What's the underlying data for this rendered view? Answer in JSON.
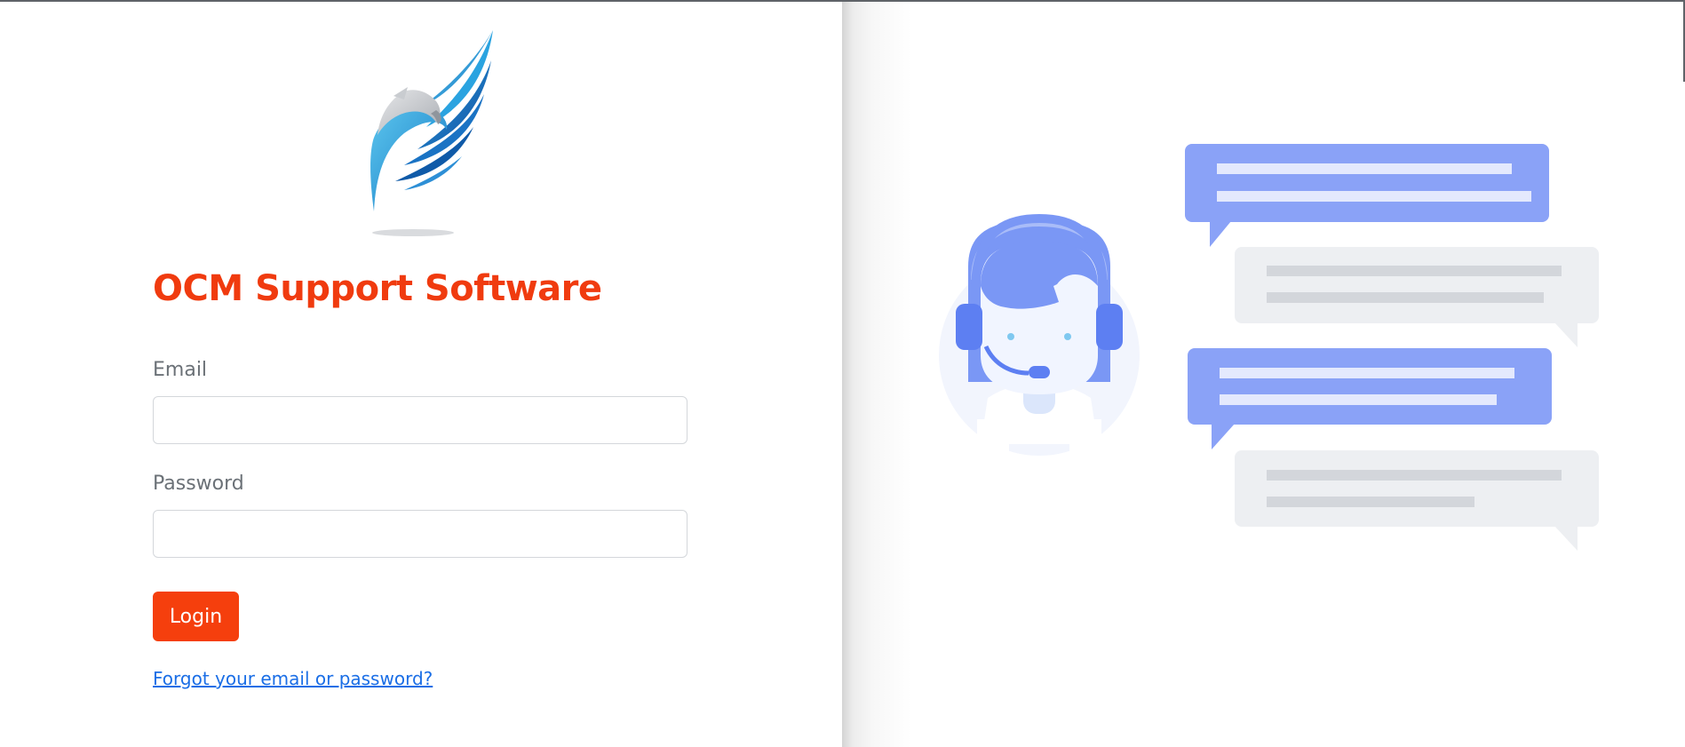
{
  "app": {
    "title": "OCM Support Software",
    "accent_color": "#f53f0d",
    "logo": "eagle-logo-icon"
  },
  "login_form": {
    "email_label": "Email",
    "email_value": "",
    "password_label": "Password",
    "password_value": "",
    "login_button": "Login",
    "forgot_link": "Forgot your email or password?"
  },
  "illustration": {
    "agent": "support-agent-headset-icon",
    "bubbles": [
      "chat-bubble-icon",
      "chat-bubble-icon",
      "chat-bubble-icon",
      "chat-bubble-icon"
    ],
    "agent_color": "#7a97f5",
    "bubble_color": "#8aa2f7",
    "reply_bubble_color": "#edeff2"
  }
}
